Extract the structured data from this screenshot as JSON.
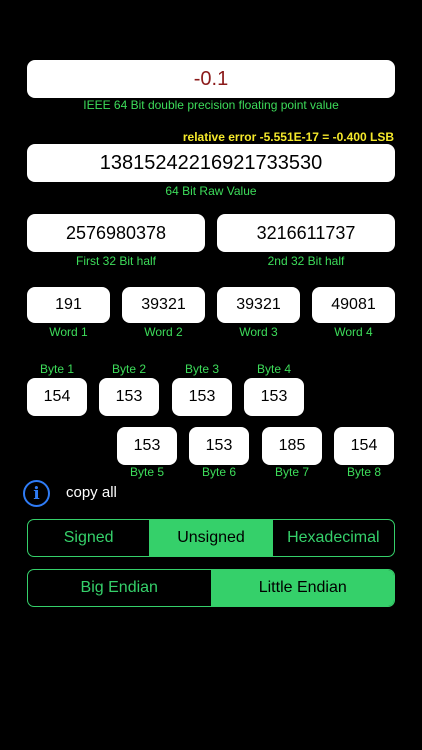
{
  "main_value": {
    "text": "-0.1",
    "label": "IEEE 64 Bit double precision floating point value"
  },
  "relative_error": "relative error -5.551E-17 = -0.400 LSB",
  "raw": {
    "text": "13815242216921733530",
    "label": "64 Bit Raw Value"
  },
  "halves": [
    {
      "value": "2576980378",
      "label": "First 32 Bit half"
    },
    {
      "value": "3216611737",
      "label": "2nd 32 Bit half"
    }
  ],
  "words": [
    {
      "value": "191",
      "label": "Word 1"
    },
    {
      "value": "39321",
      "label": "Word 2"
    },
    {
      "value": "39321",
      "label": "Word 3"
    },
    {
      "value": "49081",
      "label": "Word 4"
    }
  ],
  "bytes": [
    {
      "value": "154",
      "label": "Byte 1"
    },
    {
      "value": "153",
      "label": "Byte 2"
    },
    {
      "value": "153",
      "label": "Byte 3"
    },
    {
      "value": "153",
      "label": "Byte 4"
    },
    {
      "value": "153",
      "label": "Byte 5"
    },
    {
      "value": "153",
      "label": "Byte 6"
    },
    {
      "value": "185",
      "label": "Byte 7"
    },
    {
      "value": "154",
      "label": "Byte 8"
    }
  ],
  "copy_all": "copy all",
  "format_options": [
    "Signed",
    "Unsigned",
    "Hexadecimal"
  ],
  "format_selected": "Unsigned",
  "endian_options": [
    "Big Endian",
    "Little Endian"
  ],
  "endian_selected": "Little Endian",
  "colors": {
    "accent_green": "#35d06a",
    "label_green": "#3ddc5a",
    "error_yellow": "#f5e92b",
    "value_red": "#8b1a1a",
    "info_blue": "#2f7cf6"
  },
  "icons": {
    "info": "info-icon"
  }
}
